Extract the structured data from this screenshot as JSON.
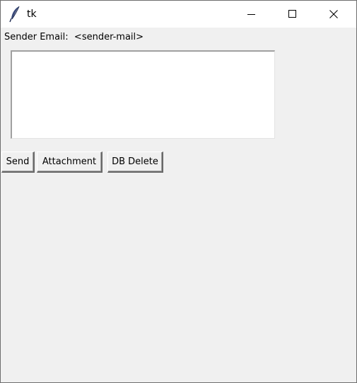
{
  "window": {
    "title": "tk",
    "controls": {
      "minimize_icon": "minimize-icon",
      "maximize_icon": "maximize-icon",
      "close_icon": "close-icon"
    }
  },
  "form": {
    "sender_label": "Sender Email:  <sender-mail>",
    "message_value": ""
  },
  "buttons": {
    "send": "Send",
    "attachment": "Attachment",
    "db_delete": "DB Delete"
  }
}
